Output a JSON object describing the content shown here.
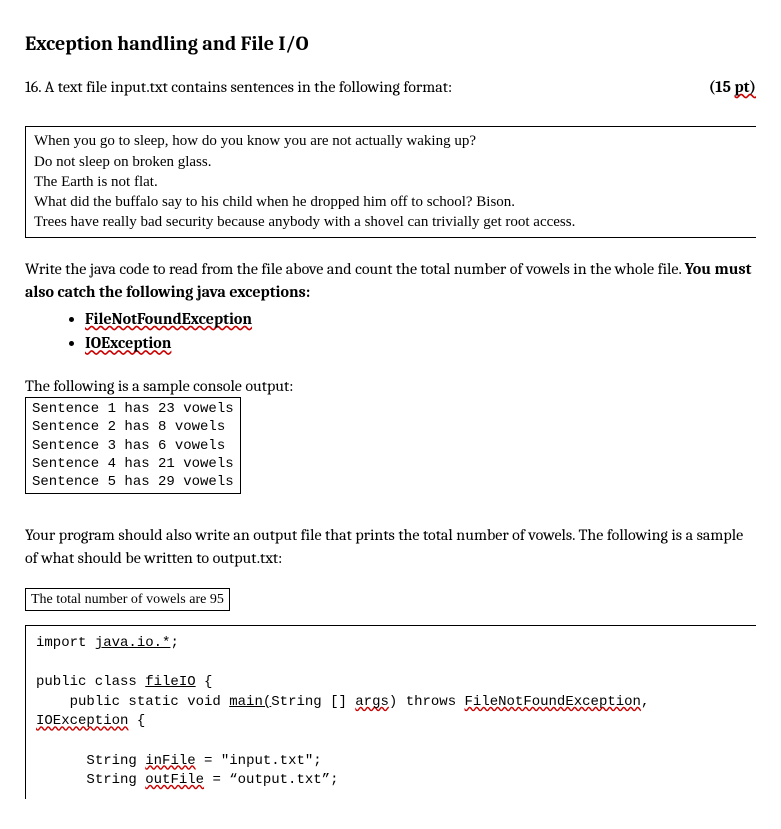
{
  "title": "Exception handling and File I/O",
  "question_number": "16.",
  "question_text": "A text file input.txt contains sentences in the following format:",
  "points_label": "(15 ",
  "points_suffix": "pt)",
  "file_contents": [
    "When you go to sleep, how do you know you are not actually waking up?",
    "Do not sleep on broken glass.",
    "The Earth is not flat.",
    "What did the buffalo say to his child when he dropped him off to school? Bison.",
    "Trees have really bad security because anybody with a shovel can trivially get root access."
  ],
  "instruction_before_bold": "Write the java code to read from the file above and count the total number of vowels in the whole file. ",
  "instruction_bold": "You must also catch the following java exceptions:",
  "exceptions": [
    "FileNotFoundException",
    "IOException"
  ],
  "sample_console_label": "The following is a sample console output:",
  "console_output": [
    "Sentence 1 has 23 vowels",
    "Sentence 2 has 8 vowels",
    "Sentence 3 has 6 vowels",
    "Sentence 4 has 21 vowels",
    "Sentence 5 has 29 vowels"
  ],
  "output_instruction": "Your program should also write an output file that prints the total number of vowels. The following is a sample of what should be written to output.txt:",
  "output_file_content": "The total number of vowels are 95",
  "code": {
    "import": "import ",
    "import_pkg": "java.io.*",
    "import_end": ";",
    "class_pre": "public class ",
    "class_name": "fileIO",
    "class_brace": " {",
    "main_pre": "    public static void ",
    "main_name": "main(",
    "main_params": "String [] ",
    "args": "args",
    "main_paren": ")",
    "throws": " throws ",
    "ex1": "FileNotFoundException",
    "comma": ", ",
    "ex2": "IOException",
    "brace": " {",
    "line1_pre": "      String ",
    "line1_var": "inFile",
    "line1_end": " = \"input.txt\";",
    "line2_pre": "      String ",
    "line2_var": "outFile",
    "line2_end": " = “output.txt”;"
  }
}
